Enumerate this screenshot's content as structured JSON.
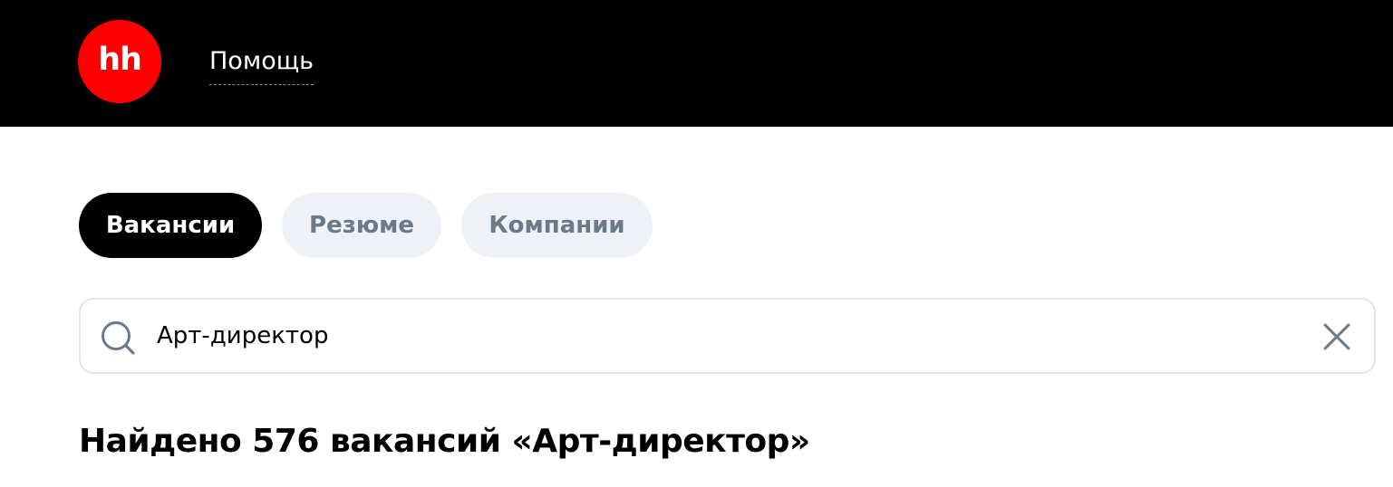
{
  "header": {
    "logo_text": "hh",
    "help_label": "Помощь"
  },
  "tabs": [
    {
      "label": "Вакансии",
      "active": true
    },
    {
      "label": "Резюме",
      "active": false
    },
    {
      "label": "Компании",
      "active": false
    }
  ],
  "search": {
    "value": "Арт-директор",
    "icon": "search-icon",
    "clear_icon": "close-icon"
  },
  "results": {
    "title": "Найдено 576 вакансий «Арт-директор»"
  },
  "colors": {
    "header_bg": "#000000",
    "logo_red": "#ff0000",
    "tab_active_bg": "#000000",
    "tab_inactive_bg": "#eef1f6",
    "tab_inactive_text": "#6b7a89",
    "search_border": "#e1e5ec",
    "icon_gray": "#6b7a89"
  }
}
